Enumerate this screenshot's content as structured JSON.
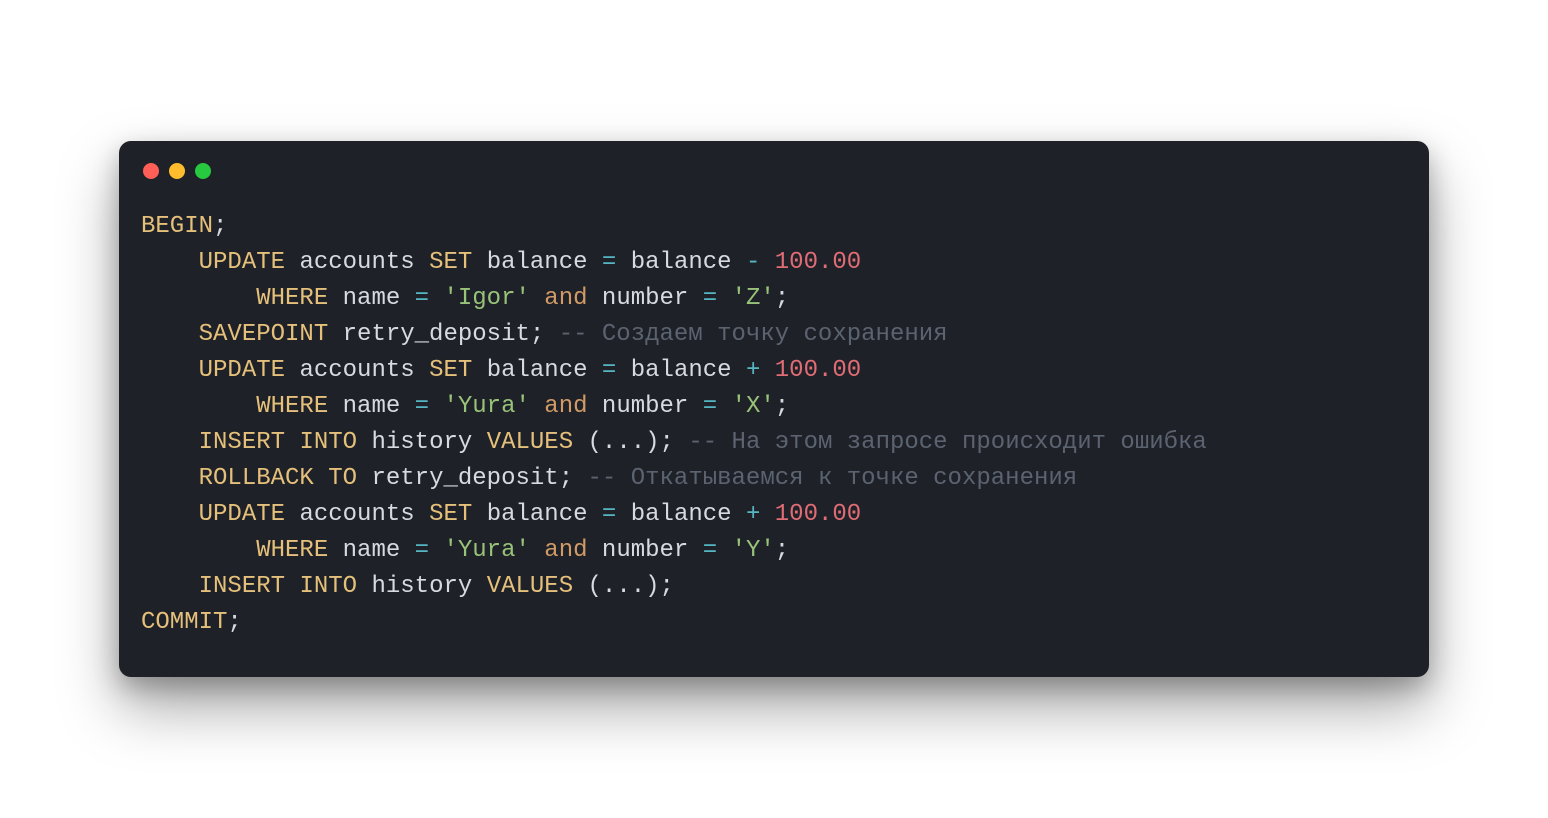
{
  "code": {
    "l1_begin": "BEGIN",
    "semi": ";",
    "update": "UPDATE",
    "accounts": "accounts",
    "set": "SET",
    "balance": "balance",
    "eq": "=",
    "minus": "-",
    "plus": "+",
    "amount": "100.00",
    "where": "WHERE",
    "name": "name",
    "igor": "'Igor'",
    "and": "and",
    "number": "number",
    "z": "'Z'",
    "savepoint": "SAVEPOINT",
    "retry_deposit": "retry_deposit",
    "cmt1": "-- Создаем точку сохранения",
    "yura": "'Yura'",
    "x": "'X'",
    "insert": "INSERT",
    "into": "INTO",
    "history": "history",
    "values": "VALUES",
    "paren_dots": "(...)",
    "cmt2": "-- На этом запросе происходит ошибка",
    "rollback": "ROLLBACK",
    "to": "TO",
    "cmt3": "-- Откатываемся к точке сохранения",
    "y": "'Y'",
    "commit": "COMMIT"
  }
}
